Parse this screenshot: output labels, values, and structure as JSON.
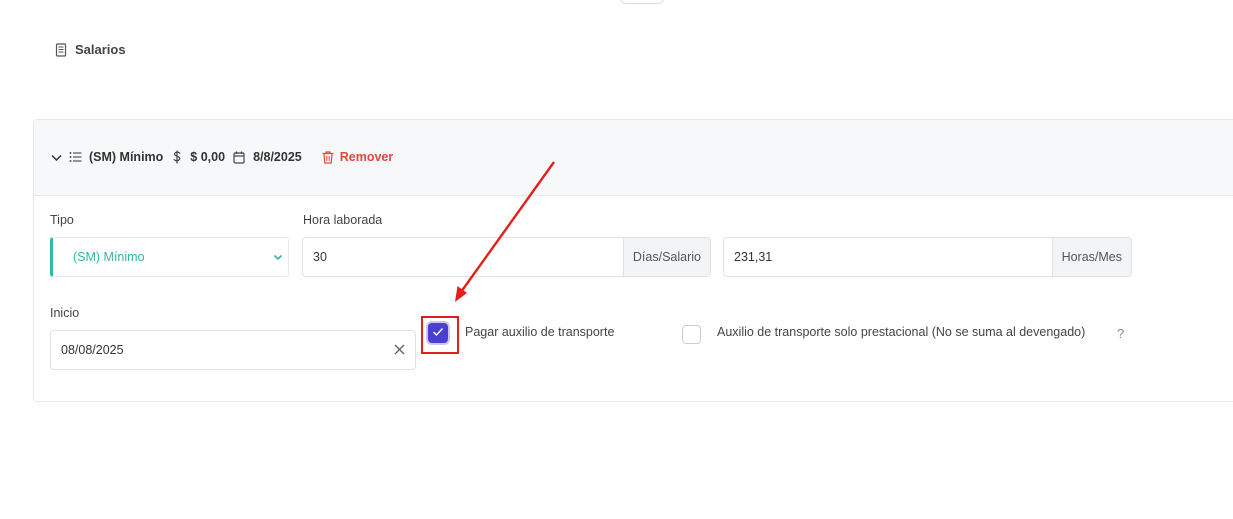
{
  "section": {
    "title": "Salarios",
    "icon": "receipt-icon"
  },
  "salary_item": {
    "header": {
      "type_name": "(SM) Mínimo",
      "amount": "$ 0,00",
      "date": "8/8/2025",
      "remove_label": "Remover"
    },
    "tipo": {
      "label": "Tipo",
      "value": "(SM) Mínimo"
    },
    "hora_laborada": {
      "label": "Hora laborada",
      "days_value": "30",
      "days_unit": "Días/Salario",
      "hours_value": "231,31",
      "hours_unit": "Horas/Mes"
    },
    "inicio": {
      "label": "Inicio",
      "value": "08/08/2025"
    },
    "pagar_auxilio": {
      "label": "Pagar auxilio de transporte",
      "checked": true
    },
    "auxilio_prestacional": {
      "label": "Auxilio de transporte solo prestacional (No se suma al devengado)",
      "checked": false,
      "help": "?"
    }
  },
  "colors": {
    "accent": "#4a3fd1",
    "teal": "#33b8a5",
    "danger": "#e2473f",
    "annotation": "#e3201b"
  }
}
